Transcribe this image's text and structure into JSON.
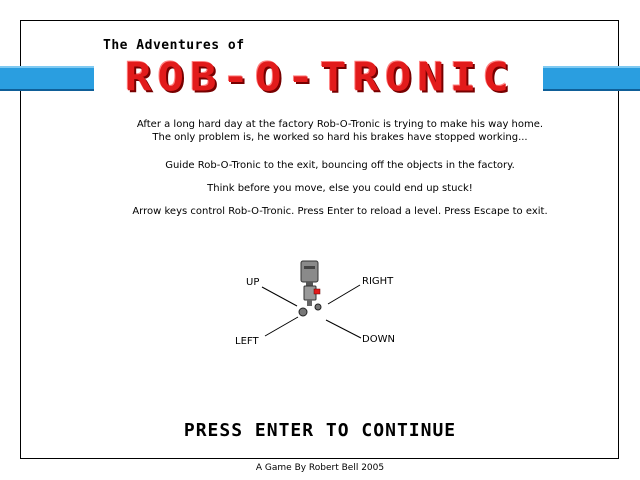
{
  "title": {
    "subtitle": "The Adventures of",
    "logo": "ROB-O-TRONIC"
  },
  "intro": {
    "line1": "After a long hard day at the factory Rob-O-Tronic is trying to make his way home.",
    "line2": "The only problem is, he worked so hard his brakes have stopped working...",
    "line3": "Guide Rob-O-Tronic to the exit, bouncing off the objects in the factory.",
    "line4": "Think before you move, else you could end up stuck!",
    "line5": "Arrow keys control Rob-O-Tronic. Press Enter to reload a level. Press Escape to exit."
  },
  "controls": {
    "up": "UP",
    "right": "RIGHT",
    "left": "LEFT",
    "down": "DOWN",
    "robot_icon": "robot-icon"
  },
  "prompt": "PRESS ENTER TO CONTINUE",
  "credit": "A Game By Robert Bell 2005",
  "colors": {
    "logo_red": "#e21b1b",
    "stripe_blue": "#2a9ee0",
    "robot_gray": "#888888"
  }
}
